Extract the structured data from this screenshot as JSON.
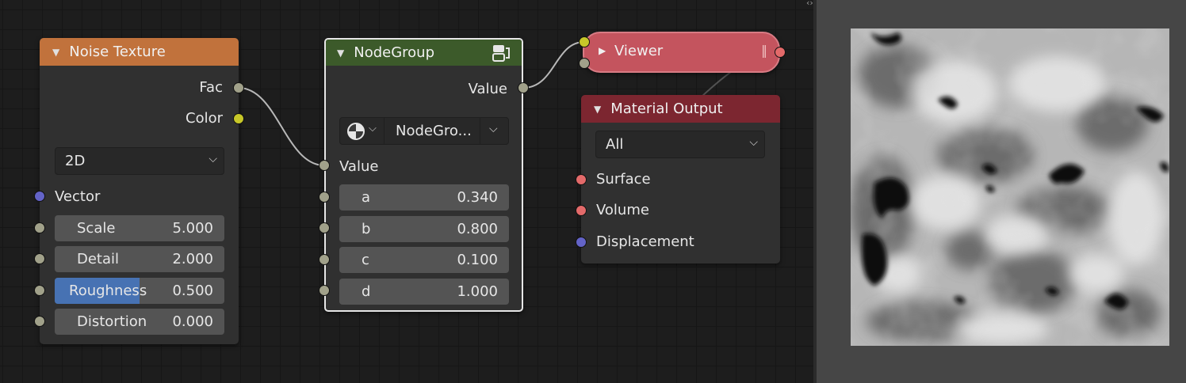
{
  "noise_node": {
    "title": "Noise Texture",
    "outputs": [
      "Fac",
      "Color"
    ],
    "dimension": "2D",
    "input_vector": "Vector",
    "fields": [
      {
        "label": "Scale",
        "value": "5.000",
        "fill": 0
      },
      {
        "label": "Detail",
        "value": "2.000",
        "fill": 0
      },
      {
        "label": "Roughness",
        "value": "0.500",
        "fill": 0.5
      },
      {
        "label": "Distortion",
        "value": "0.000",
        "fill": 0
      }
    ]
  },
  "nodegroup_node": {
    "title": "NodeGroup",
    "output": "Value",
    "group_name": "NodeGro...",
    "input_value": "Value",
    "fields": [
      {
        "label": "a",
        "value": "0.340"
      },
      {
        "label": "b",
        "value": "0.800"
      },
      {
        "label": "c",
        "value": "0.100"
      },
      {
        "label": "d",
        "value": "1.000"
      }
    ]
  },
  "viewer_node": {
    "title": "Viewer"
  },
  "material_output_node": {
    "title": "Material Output",
    "target": "All",
    "inputs": [
      "Surface",
      "Volume",
      "Displacement"
    ]
  },
  "icons": {
    "collapse": "triangle-down-icon",
    "collapsed": "triangle-right-icon",
    "dropdown": "chevron-down-icon",
    "group": "node-group-icon",
    "shading": "shading-sphere-icon"
  },
  "colors": {
    "noise_header": "#c1723c",
    "nodegroup_header": "#3c5a2a",
    "viewer_header": "#c4545e",
    "material_header": "#7c2630",
    "active_border": "#e6e6e6",
    "slider_fill": "#4772b3"
  }
}
